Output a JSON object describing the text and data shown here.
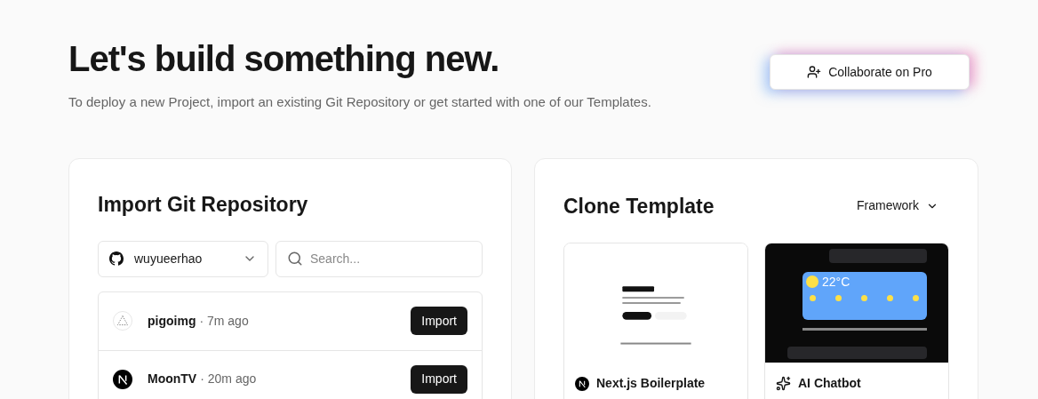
{
  "header": {
    "title": "Let's build something new.",
    "subtitle": "To deploy a new Project, import an existing Git Repository or get started with one of our Templates.",
    "collaborate_button": "Collaborate on Pro"
  },
  "import_panel": {
    "title": "Import Git Repository",
    "account": "wuyueerhao",
    "search": {
      "placeholder": "Search..."
    },
    "repos": [
      {
        "name": "pigoimg",
        "age": "· 7m ago",
        "kind": "triangle",
        "button": "Import"
      },
      {
        "name": "MoonTV",
        "age": "· 20m ago",
        "kind": "next",
        "button": "Import"
      }
    ]
  },
  "clone_panel": {
    "title": "Clone Template",
    "filter": "Framework",
    "templates": [
      {
        "name": "Next.js Boilerplate",
        "kind": "next"
      },
      {
        "name": "AI Chatbot",
        "kind": "chatbot",
        "temperature": "22°C"
      }
    ]
  }
}
